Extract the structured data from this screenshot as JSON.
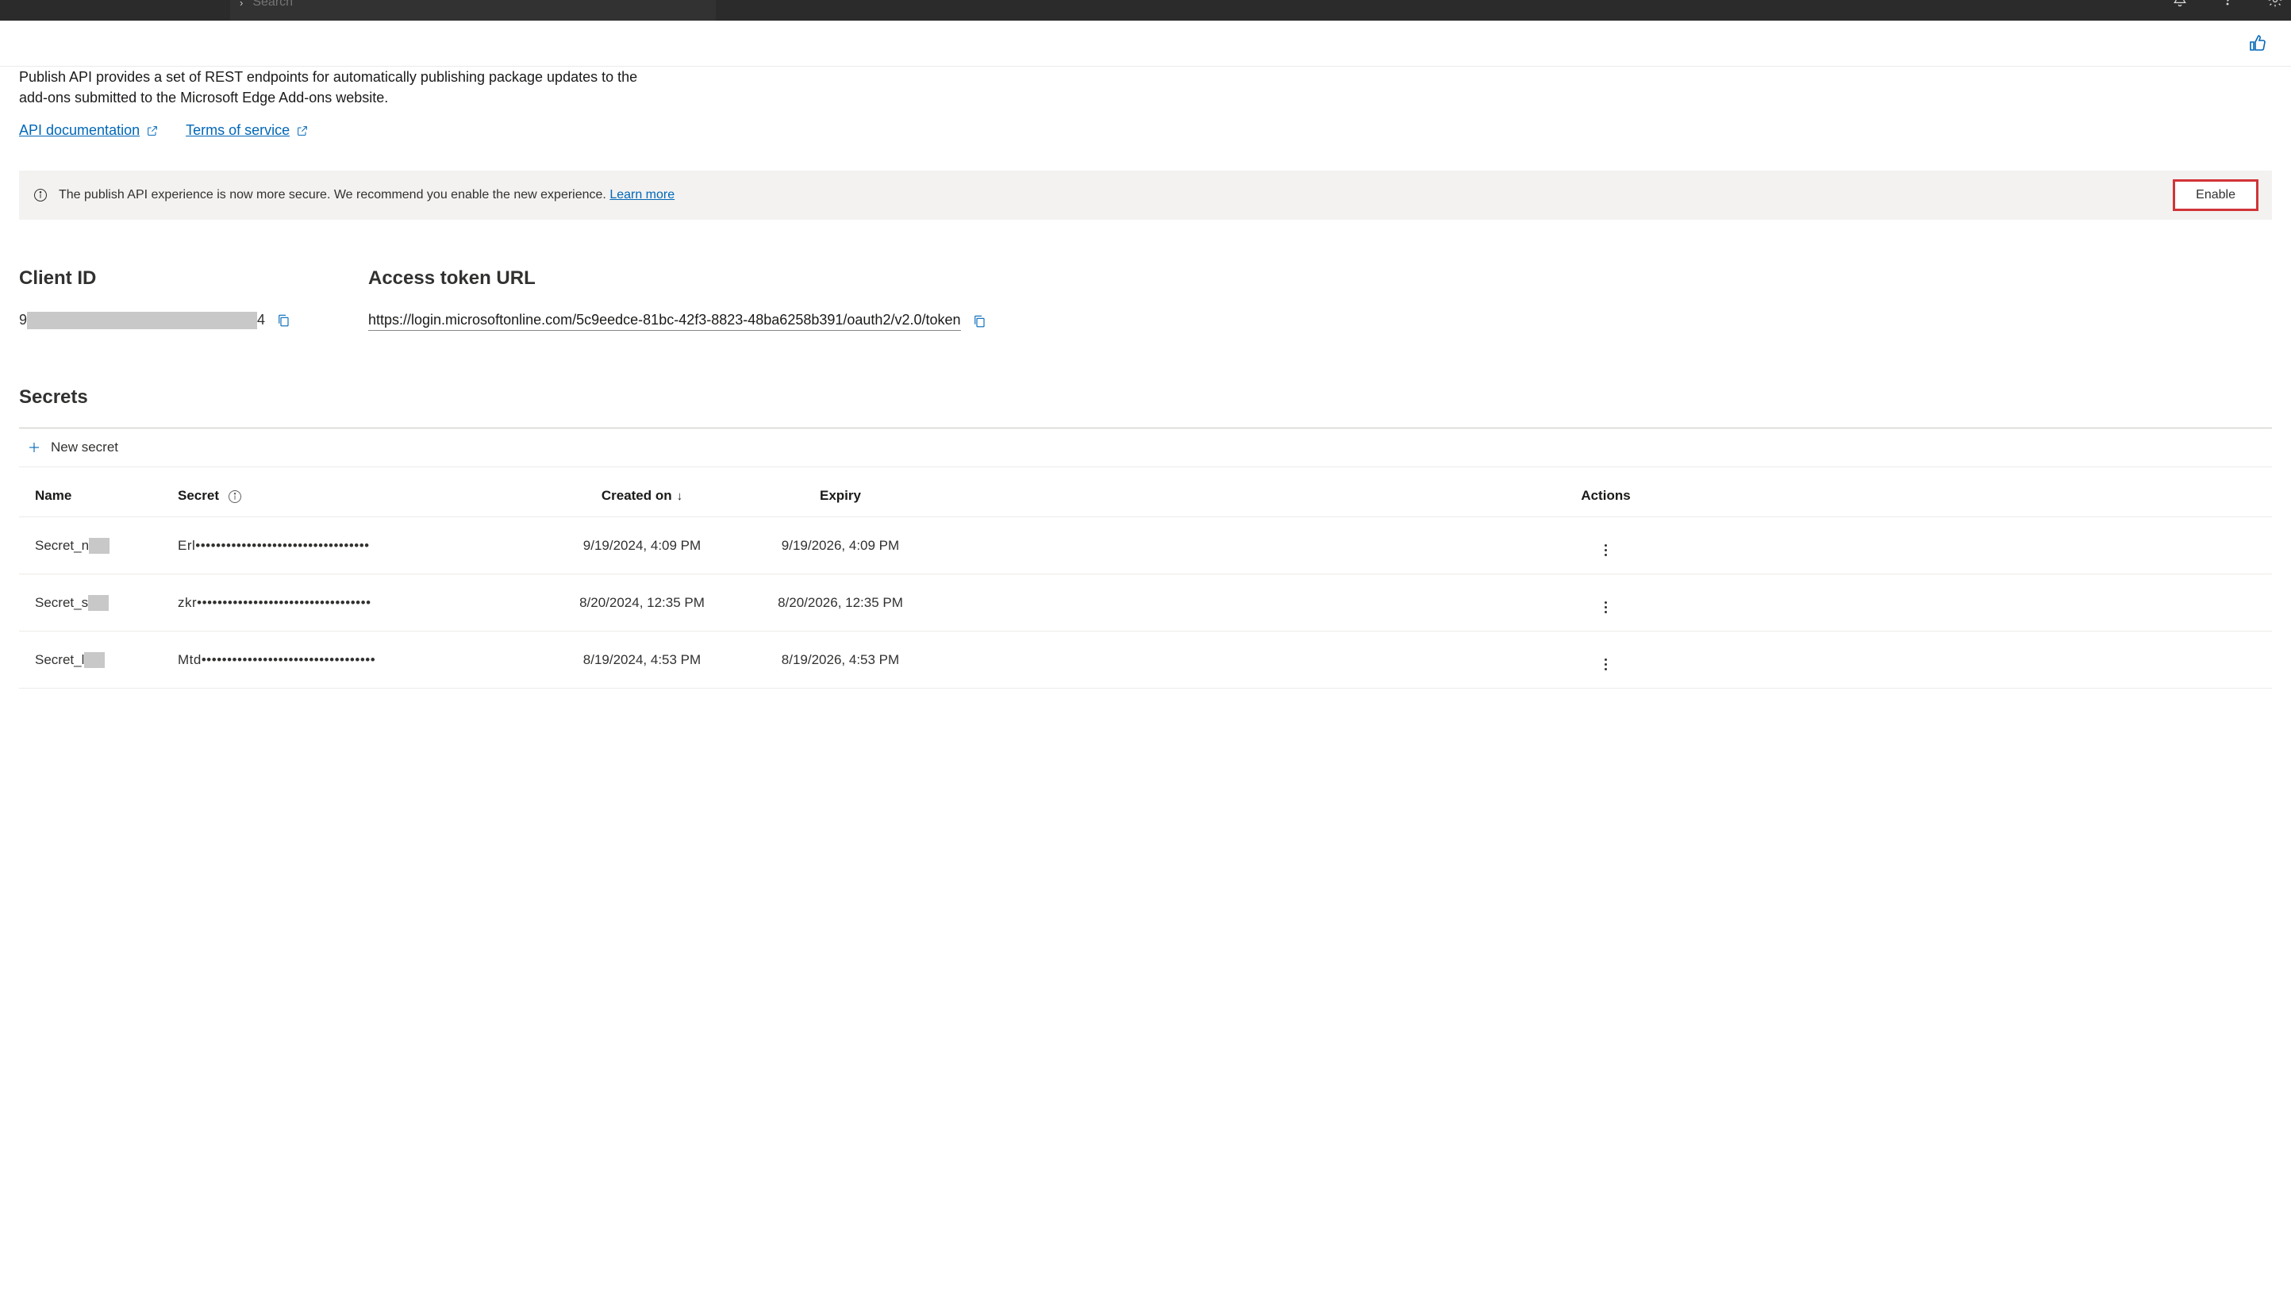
{
  "topbar": {
    "search_placeholder": "Search"
  },
  "description": "Publish API provides a set of REST endpoints for automatically publishing package updates to the add-ons submitted to the Microsoft Edge Add-ons website.",
  "links": {
    "api_doc": "API documentation",
    "tos": "Terms of service"
  },
  "banner": {
    "text": "The publish API experience is now more secure. We recommend you enable the new experience. ",
    "learn_more": "Learn more",
    "enable_btn": "Enable"
  },
  "client_id": {
    "label": "Client ID",
    "prefix": "9",
    "suffix": "4"
  },
  "token_url": {
    "label": "Access token URL",
    "value": "https://login.microsoftonline.com/5c9eedce-81bc-42f3-8823-48ba6258b391/oauth2/v2.0/token"
  },
  "secrets": {
    "heading": "Secrets",
    "new_btn": "New secret",
    "columns": {
      "name": "Name",
      "secret": "Secret",
      "created": "Created on",
      "expiry": "Expiry",
      "actions": "Actions"
    },
    "rows": [
      {
        "name_prefix": "Secret_n",
        "secret": "Erl••••••••••••••••••••••••••••••••••",
        "created": "9/19/2024, 4:09 PM",
        "expiry": "9/19/2026, 4:09 PM"
      },
      {
        "name_prefix": "Secret_s",
        "secret": "zkr••••••••••••••••••••••••••••••••••",
        "created": "8/20/2024, 12:35 PM",
        "expiry": "8/20/2026, 12:35 PM"
      },
      {
        "name_prefix": "Secret_l",
        "secret": "Mtd••••••••••••••••••••••••••••••••••",
        "created": "8/19/2024, 4:53 PM",
        "expiry": "8/19/2026, 4:53 PM"
      }
    ]
  }
}
